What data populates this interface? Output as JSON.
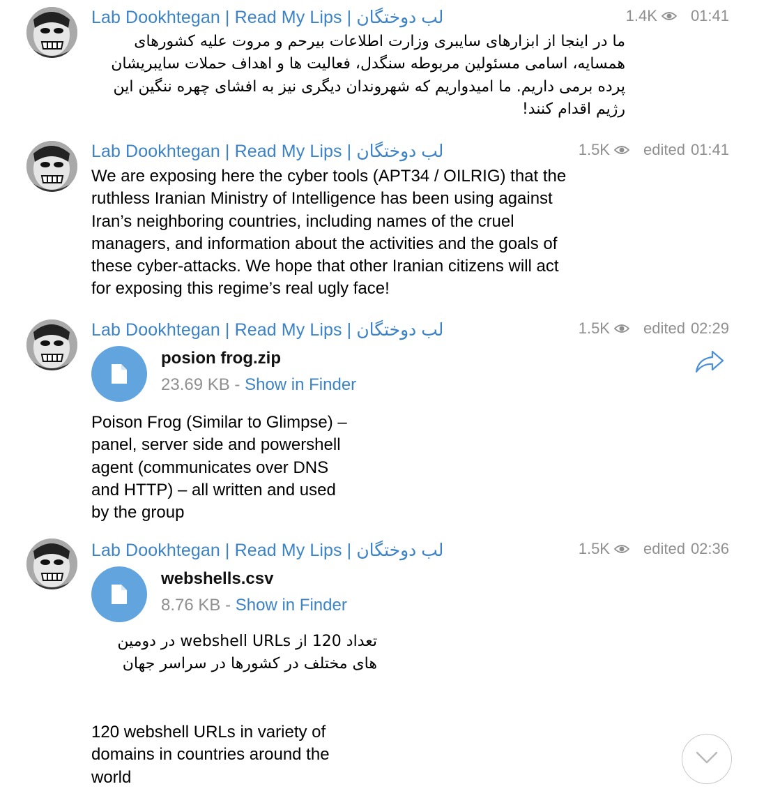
{
  "messages": [
    {
      "sender": "Lab Dookhtegan | Read My Lips | لب دوختگان",
      "views": "1.4K",
      "edited": "",
      "time": "01:41",
      "text": "ما در اینجا از ابزارهای سایبری وزارت اطلاعات بیرحم و مروت علیه کشورهای همسایه، اسامی مسئولین مربوطه سنگدل، فعالیت ها و اهداف حملات سایبریشان پرده برمی داریم. ما امیدواریم که شهروندان دیگری نیز به افشای چهره ننگین این رژیم اقدام کنند!"
    },
    {
      "sender": "Lab Dookhtegan | Read My Lips | لب دوختگان",
      "views": "1.5K",
      "edited": "edited",
      "time": "01:41",
      "text": "We are exposing here the cyber tools (APT34 / OILRIG) that the\nruthless Iranian Ministry of Intelligence has been using against\nIran’s neighboring countries, including names of the cruel\nmanagers, and information about the activities and the goals of\nthese cyber-attacks.  We hope that other Iranian citizens will act\nfor exposing this regime’s real ugly face!"
    },
    {
      "sender": "Lab Dookhtegan | Read My Lips | لب دوختگان",
      "views": "1.5K",
      "edited": "edited",
      "time": "02:29",
      "file": {
        "name": "posion frog.zip",
        "size": "23.69 KB",
        "separator": "-",
        "action": "Show in Finder"
      },
      "text": "Poison Frog (Similar to Glimpse) –\npanel, server side and powershell\nagent (communicates over DNS\nand HTTP) – all written and used\nby the group"
    },
    {
      "sender": "Lab Dookhtegan | Read My Lips | لب دوختگان",
      "views": "1.5K",
      "edited": "edited",
      "time": "02:36",
      "file": {
        "name": "webshells.csv",
        "size": "8.76 KB",
        "separator": "-",
        "action": "Show in Finder"
      },
      "text_fa": "تعداد 120 از webshell URLs در دومین های مختلف در کشورها در سراسر جهان",
      "text": "120 webshell URLs in variety of\ndomains in countries around the\nworld"
    }
  ],
  "icons": {
    "avatar": "avatar-image",
    "views": "eye-icon",
    "file": "document-icon",
    "share": "share-arrow-icon",
    "scroll": "chevron-down-icon"
  },
  "colors": {
    "accent": "#3b83c6",
    "file_icon_bg": "#62a4dd",
    "meta": "#8f8f8f"
  }
}
